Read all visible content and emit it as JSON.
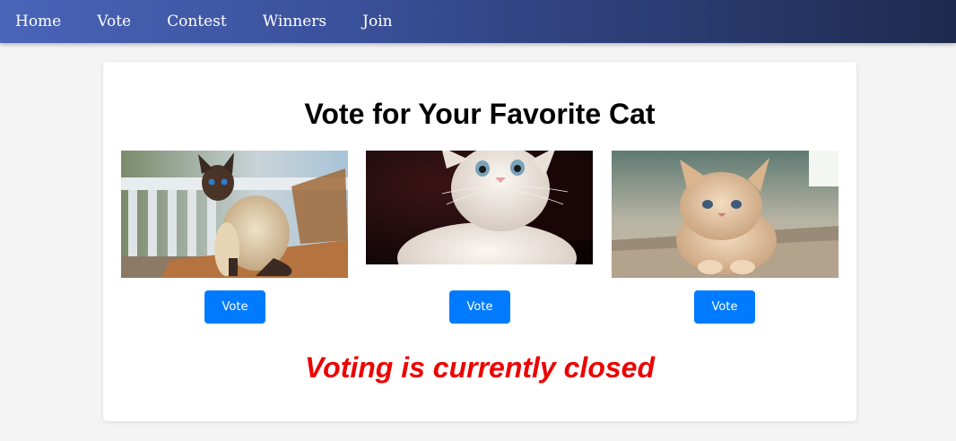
{
  "nav": {
    "items": [
      {
        "label": "Home"
      },
      {
        "label": "Vote"
      },
      {
        "label": "Contest"
      },
      {
        "label": "Winners"
      },
      {
        "label": "Join"
      }
    ]
  },
  "main": {
    "title": "Vote for Your Favorite Cat",
    "cats": [
      {
        "image": "siamese-cat-photo",
        "vote_label": "Vote"
      },
      {
        "image": "white-kitten-photo",
        "vote_label": "Vote"
      },
      {
        "image": "cream-fluffy-kitten-photo",
        "vote_label": "Vote"
      }
    ],
    "status": "Voting is currently closed"
  },
  "colors": {
    "accent": "#007bff",
    "status": "#ee0000",
    "nav_start": "#4a64b8",
    "nav_end": "#1e2a4e"
  }
}
